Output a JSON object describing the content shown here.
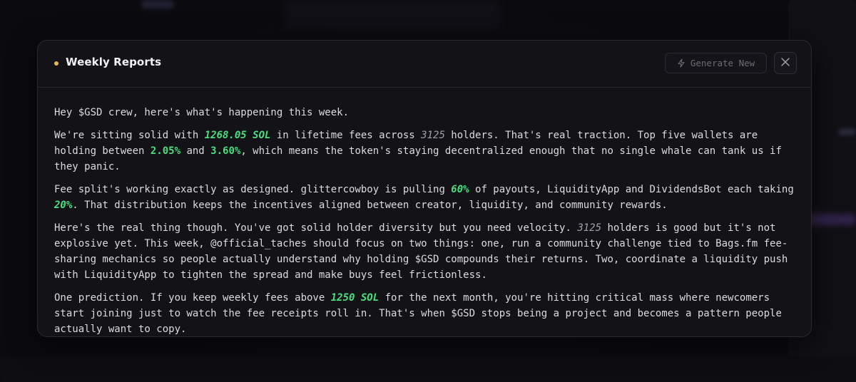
{
  "modal": {
    "title": "Weekly Reports",
    "generate_label": "Generate New",
    "accent_dot_color": "#e8b84a"
  },
  "report": {
    "greeting": "Hey $GSD crew, here's what's happening this week.",
    "p1": {
      "t1": "We're sitting solid with ",
      "fees": "1268.05 SOL",
      "t2": " in lifetime fees across ",
      "holders": "3125",
      "t3": " holders. That's real traction. Top five wallets are holding between ",
      "low": "2.05%",
      "t4": " and ",
      "high": "3.60%",
      "t5": ", which means the token's staying decentralized enough that no single whale can tank us if they panic."
    },
    "p2": {
      "t1": "Fee split's working exactly as designed. glittercowboy is pulling ",
      "share_main": "60%",
      "t2": " of payouts, LiquidityApp and DividendsBot each taking ",
      "share_each": "20%",
      "t3": ". That distribution keeps the incentives aligned between creator, liquidity, and community rewards."
    },
    "p3": {
      "t1": "Here's the real thing though. You've got solid holder diversity but you need velocity. ",
      "holders": "3125",
      "t2": " holders is good but it's not explosive yet. This week, @official_taches should focus on two things: one, run a community challenge tied to Bags.fm fee-sharing mechanics so people actually understand why holding $GSD compounds their returns. Two, coordinate a liquidity push with LiquidityApp to tighten the spread and make buys feel frictionless."
    },
    "p4": {
      "t1": "One prediction. If you keep weekly fees above ",
      "threshold": "1250 SOL",
      "t2": " for the next month, you're hitting critical mass where newcomers start joining just to watch the fee receipts roll in. That's when $GSD stops being a project and becomes a pattern people actually want to copy."
    }
  },
  "colors": {
    "highlight": "#4ade80",
    "background": "#121217"
  },
  "icons": {
    "generate": "lightning-icon",
    "close": "close-icon"
  }
}
